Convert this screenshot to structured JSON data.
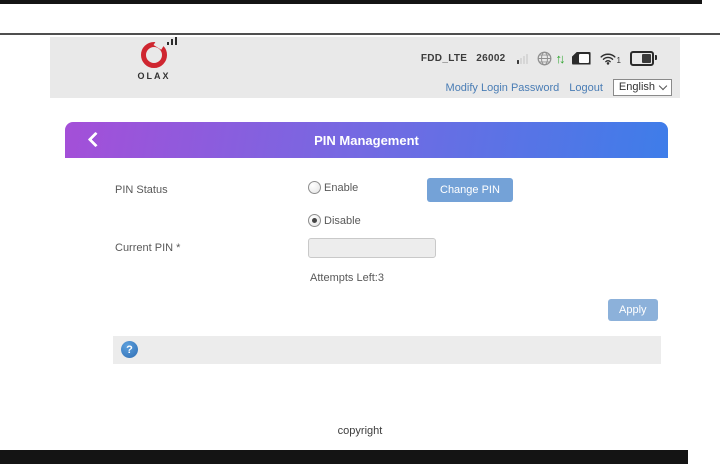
{
  "brand": {
    "name": "OLAX"
  },
  "statusbar": {
    "network_type": "FDD_LTE",
    "operator_code": "26002",
    "wifi_client_count": "1",
    "icons": [
      "signal-bars-icon",
      "globe-icon",
      "traffic-arrows-icon",
      "sim-card-icon",
      "wifi-icon",
      "battery-icon"
    ],
    "traffic_arrows_glyph": "↑↓"
  },
  "account_links": {
    "modify_login_password": "Modify Login Password",
    "logout": "Logout",
    "language_selected": "English"
  },
  "titlebar": {
    "title": "PIN Management"
  },
  "form": {
    "pin_status_label": "PIN Status",
    "options": [
      {
        "label": "Enable",
        "checked": false
      },
      {
        "label": "Disable",
        "checked": true
      }
    ],
    "change_pin_button": "Change PIN",
    "current_pin_label": "Current PIN *",
    "current_pin_value": "",
    "attempts_left": "Attempts Left:3",
    "apply_button": "Apply"
  },
  "help": {
    "glyph": "?"
  },
  "footer": {
    "copyright": "copyright"
  },
  "colors": {
    "gradient_start": "#a44fd8",
    "gradient_end": "#3e7de9",
    "change_pin_button": "#74a2d7",
    "apply_button": "#8cb1da",
    "link_blue": "#4a7db5",
    "logo_red": "#cf2630",
    "arrow_green": "#2ea52e",
    "header_gray": "#e9e9e9"
  }
}
